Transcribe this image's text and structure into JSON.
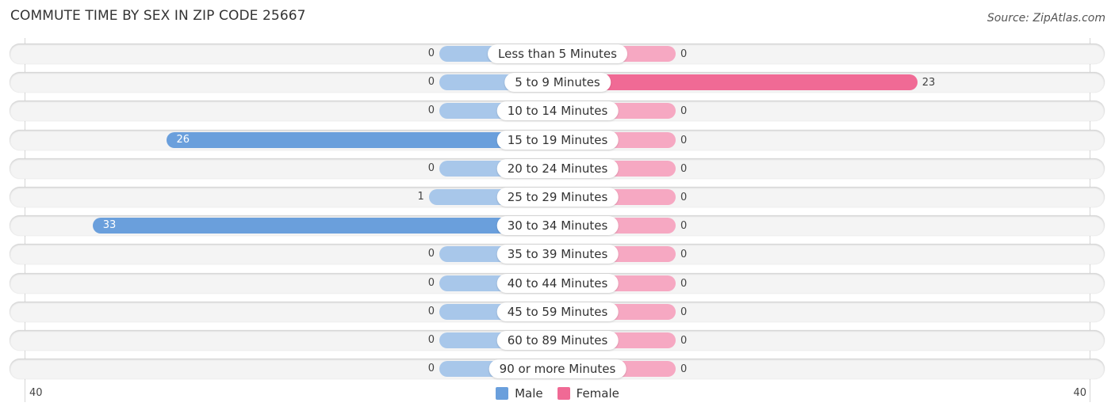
{
  "title": "COMMUTE TIME BY SEX IN ZIP CODE 25667",
  "source": "Source: ZipAtlas.com",
  "colors": {
    "male": "#6a9fdc",
    "male_light": "#a8c7ea",
    "female": "#f06a95",
    "female_light": "#f6a8c2"
  },
  "chart_data": {
    "type": "bar",
    "orientation": "horizontal-diverging",
    "title": "COMMUTE TIME BY SEX IN ZIP CODE 25667",
    "categories": [
      "Less than 5 Minutes",
      "5 to 9 Minutes",
      "10 to 14 Minutes",
      "15 to 19 Minutes",
      "20 to 24 Minutes",
      "25 to 29 Minutes",
      "30 to 34 Minutes",
      "35 to 39 Minutes",
      "40 to 44 Minutes",
      "45 to 59 Minutes",
      "60 to 89 Minutes",
      "90 or more Minutes"
    ],
    "series": [
      {
        "name": "Male",
        "values": [
          0,
          0,
          0,
          26,
          0,
          1,
          33,
          0,
          0,
          0,
          0,
          0
        ]
      },
      {
        "name": "Female",
        "values": [
          0,
          23,
          0,
          0,
          0,
          0,
          0,
          0,
          0,
          0,
          0,
          0
        ]
      }
    ],
    "axis": {
      "left_label": "40",
      "right_label": "40",
      "range": [
        -40,
        40
      ]
    },
    "legend": {
      "position": "bottom-center",
      "entries": [
        "Male",
        "Female"
      ]
    }
  }
}
